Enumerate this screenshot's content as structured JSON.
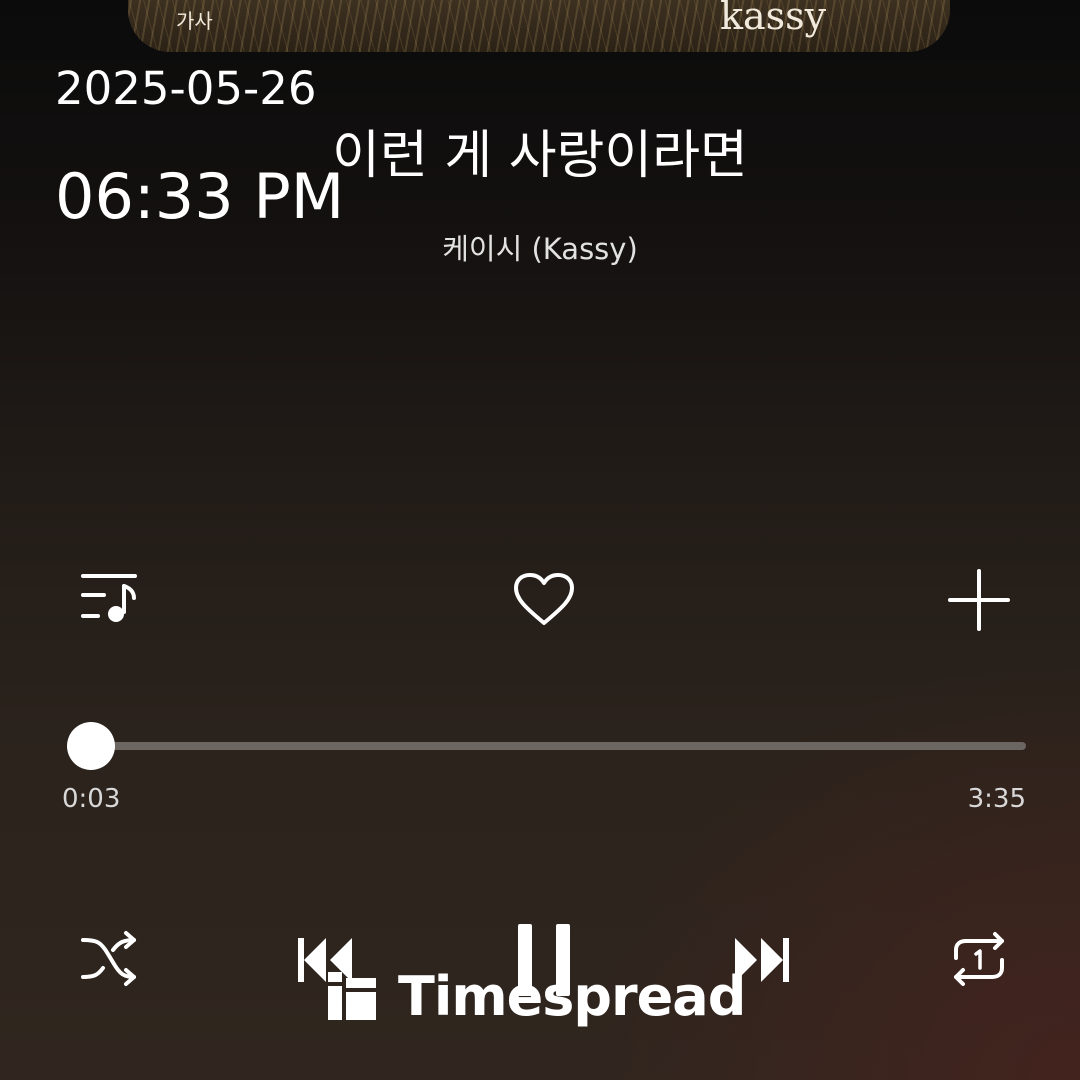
{
  "album": {
    "lyrics_label": "가사",
    "artist_text": "kassy"
  },
  "status": {
    "date": "2025-05-26",
    "time": "06:33 PM"
  },
  "track": {
    "title": "이런 게 사랑이라면",
    "artist": "케이시 (Kassy)"
  },
  "actions": {
    "playlist_icon": "playlist-icon",
    "like_icon": "heart-icon",
    "add_icon": "plus-icon"
  },
  "progress": {
    "elapsed": "0:03",
    "total": "3:35",
    "fraction": 0.014
  },
  "controls": {
    "shuffle_icon": "shuffle-icon",
    "previous_icon": "previous-icon",
    "pause_icon": "pause-icon",
    "next_icon": "next-icon",
    "repeat_icon": "repeat-one-icon"
  },
  "watermark": {
    "text": "Timespread"
  },
  "colors": {
    "accent": "#ffffff",
    "track": "#6c6662"
  }
}
